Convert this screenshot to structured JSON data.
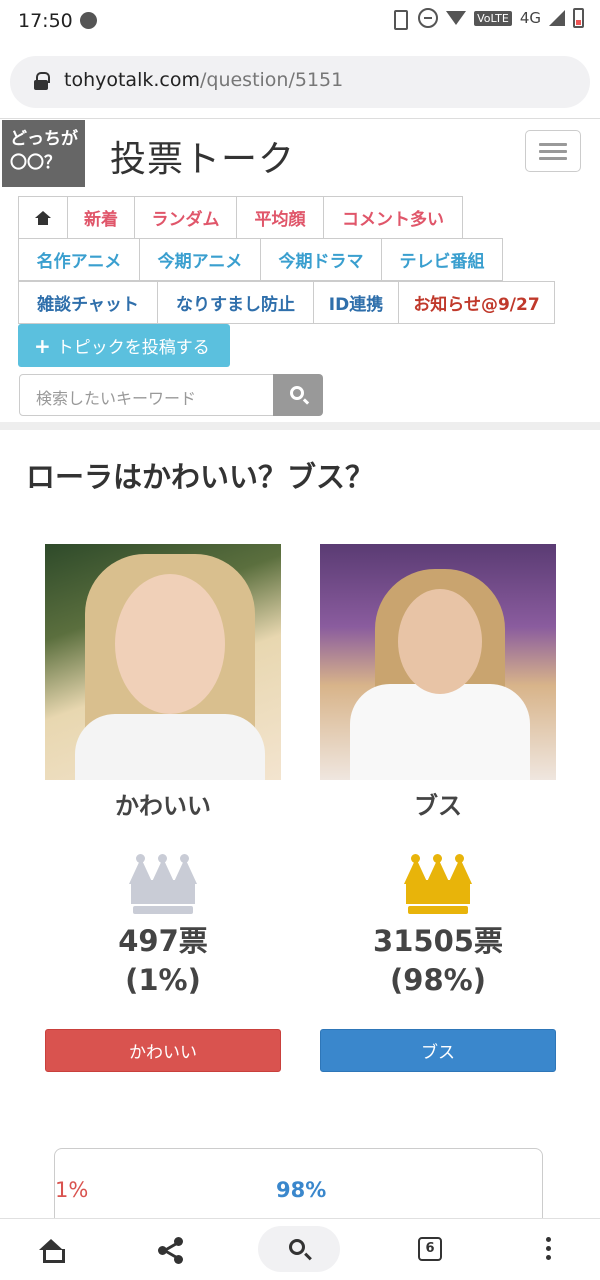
{
  "status": {
    "time": "17:50",
    "network": "VoLTE",
    "type": "4G"
  },
  "browser": {
    "url_host": "tohyotalk.com",
    "url_path": "/question/5151",
    "tab_count": "6"
  },
  "header": {
    "logo_line1": "どっちが",
    "logo_line2": "〇〇？",
    "title": "投票トーク"
  },
  "nav": {
    "row1": [
      "新着",
      "ランダム",
      "平均顔",
      "コメント多い"
    ],
    "row2": [
      "名作アニメ",
      "今期アニメ",
      "今期ドラマ",
      "テレビ番組"
    ],
    "row3": [
      "雑談チャット",
      "なりすまし防止",
      "ID連携",
      "お知らせ@9/27"
    ],
    "post_button": "トピックを投稿する",
    "post_icon": "+"
  },
  "search": {
    "placeholder": "検索したいキーワード"
  },
  "question": {
    "title": "ローラはかわいい？ブス？"
  },
  "choices": [
    {
      "label": "かわいい",
      "votes": "497票",
      "percent": "(1%)",
      "button": "かわいい",
      "crown": "silver",
      "color": "#d9534f"
    },
    {
      "label": "ブス",
      "votes": "31505票",
      "percent": "(98%)",
      "button": "ブス",
      "crown": "gold",
      "color": "#3a87cc"
    }
  ],
  "result": {
    "left_pct": "1%",
    "right_pct": "98%"
  }
}
